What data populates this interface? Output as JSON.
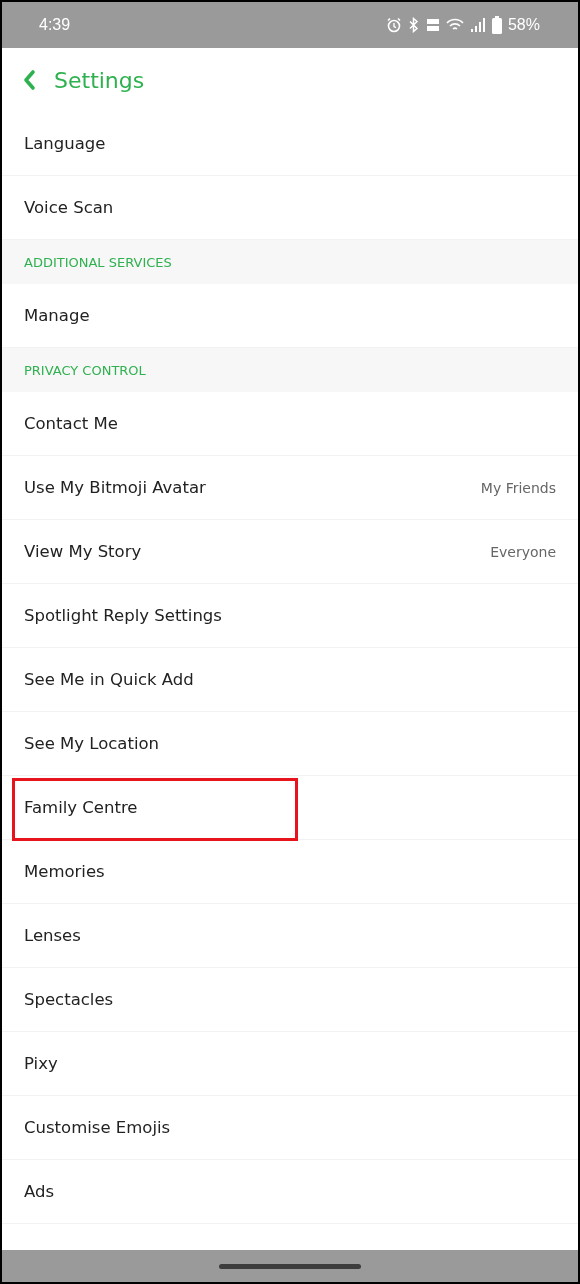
{
  "status_bar": {
    "time": "4:39",
    "battery": "58%"
  },
  "header": {
    "title": "Settings"
  },
  "items": [
    {
      "kind": "row",
      "label": "Language",
      "highlighted": false
    },
    {
      "kind": "row",
      "label": "Voice Scan",
      "highlighted": false
    },
    {
      "kind": "section",
      "label": "ADDITIONAL SERVICES"
    },
    {
      "kind": "row",
      "label": "Manage",
      "highlighted": false
    },
    {
      "kind": "section",
      "label": "PRIVACY CONTROL"
    },
    {
      "kind": "row",
      "label": "Contact Me",
      "highlighted": false
    },
    {
      "kind": "row",
      "label": "Use My Bitmoji Avatar",
      "value": "My Friends",
      "highlighted": false
    },
    {
      "kind": "row",
      "label": "View My Story",
      "value": "Everyone",
      "highlighted": false
    },
    {
      "kind": "row",
      "label": "Spotlight Reply Settings",
      "highlighted": false
    },
    {
      "kind": "row",
      "label": "See Me in Quick Add",
      "highlighted": false
    },
    {
      "kind": "row",
      "label": "See My Location",
      "highlighted": false
    },
    {
      "kind": "row",
      "label": "Family Centre",
      "highlighted": true
    },
    {
      "kind": "row",
      "label": "Memories",
      "highlighted": false
    },
    {
      "kind": "row",
      "label": "Lenses",
      "highlighted": false
    },
    {
      "kind": "row",
      "label": "Spectacles",
      "highlighted": false
    },
    {
      "kind": "row",
      "label": "Pixy",
      "highlighted": false
    },
    {
      "kind": "row",
      "label": "Customise Emojis",
      "highlighted": false
    },
    {
      "kind": "row",
      "label": "Ads",
      "highlighted": false
    }
  ]
}
